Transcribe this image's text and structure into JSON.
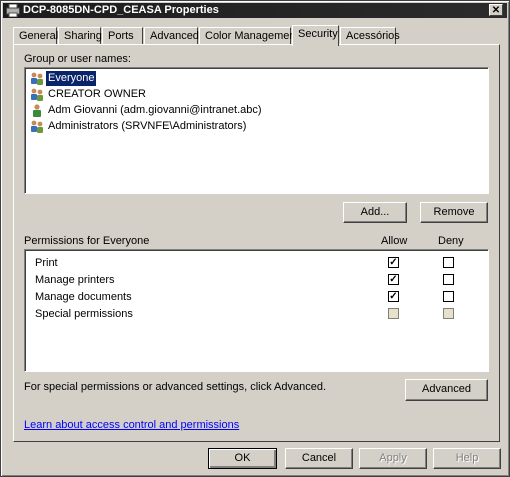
{
  "window": {
    "title": "DCP-8085DN-CPD_CEASA Properties",
    "close_glyph": "✕"
  },
  "tabs": [
    {
      "label": "General"
    },
    {
      "label": "Sharing"
    },
    {
      "label": "Ports"
    },
    {
      "label": "Advanced"
    },
    {
      "label": "Color Management"
    },
    {
      "label": "Security",
      "active": true
    },
    {
      "label": "Acessórios"
    }
  ],
  "security": {
    "group_label": "Group or user names:",
    "users": [
      {
        "name": "Everyone",
        "icon": "group-icon",
        "selected": true
      },
      {
        "name": "CREATOR OWNER",
        "icon": "group-icon"
      },
      {
        "name": "Adm Giovanni (adm.giovanni@intranet.abc)",
        "icon": "user-icon"
      },
      {
        "name": "Administrators (SRVNFE\\Administrators)",
        "icon": "group-icon"
      }
    ],
    "add_label": "Add...",
    "remove_label": "Remove",
    "permissions_label": "Permissions for Everyone",
    "allow_header": "Allow",
    "deny_header": "Deny",
    "permissions": [
      {
        "name": "Print",
        "allow": true,
        "deny": false,
        "disabled": false
      },
      {
        "name": "Manage printers",
        "allow": true,
        "deny": false,
        "disabled": false
      },
      {
        "name": "Manage documents",
        "allow": true,
        "deny": false,
        "disabled": false
      },
      {
        "name": "Special permissions",
        "allow": false,
        "deny": false,
        "disabled": true
      }
    ],
    "advanced_text": "For special permissions or advanced settings, click Advanced.",
    "advanced_label": "Advanced",
    "learn_link": "Learn about access control and permissions"
  },
  "footer": {
    "ok_label": "OK",
    "cancel_label": "Cancel",
    "apply_label": "Apply",
    "help_label": "Help"
  },
  "colors": {
    "selection": "#0a246a",
    "dialog_bg": "#d4d0c8",
    "link": "#0000ff"
  }
}
